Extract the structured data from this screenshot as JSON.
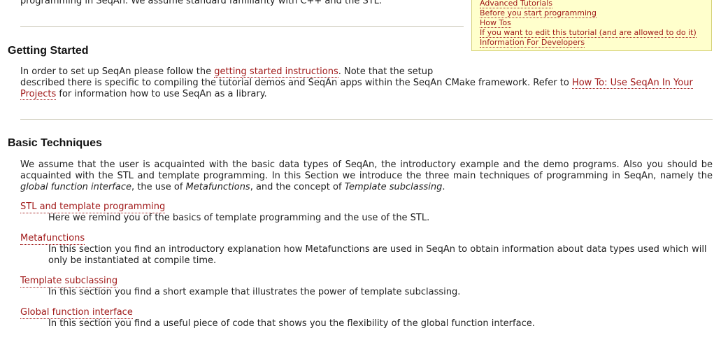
{
  "intro": {
    "partial_line": "programming in SeqAn. We assume standard familiarity with C++ and the STL."
  },
  "toc_box": {
    "items": [
      "Advanced Tutorials",
      "Before you start programming",
      "How Tos",
      "If you want to edit this tutorial (and are allowed to do it)",
      "Information For Developers"
    ]
  },
  "getting_started": {
    "heading": "Getting Started",
    "text_1": "In order to set up SeqAn please follow the ",
    "link_1": "getting started instructions",
    "text_2": ". Note that the setup",
    "text_3": "described there is specific to compiling the tutorial demos and SeqAn apps within the SeqAn CMake framework. Refer to ",
    "link_2": "How To: Use SeqAn In Your Projects",
    "text_4": " for information how to use SeqAn as a library."
  },
  "basic_techniques": {
    "heading": "Basic Techniques",
    "intro_1": "We assume that the user is acquainted with the basic data types of SeqAn, the introductory example and the demo programs. Also you should be acquainted with the STL and template programming. In this Section we introduce the three main techniques of programming in SeqAn, namely the ",
    "em_1": "global function interface",
    "intro_2": ", the use of ",
    "em_2": "Metafunctions",
    "intro_3": ", and the concept of ",
    "em_3": "Template subclassing",
    "intro_4": ".",
    "entries": [
      {
        "term": "STL and template programming",
        "desc": "Here we remind you of the basics of template programming and the use of the STL."
      },
      {
        "term": "Metafunctions",
        "desc": "In this section you find an introductory explanation how Metafunctions are used in SeqAn to obtain information about data types used which will only be instantiated at compile time."
      },
      {
        "term": "Template subclassing",
        "desc": "In this section you find a short example that illustrates the power of template subclassing."
      },
      {
        "term": "Global function interface",
        "desc": "In this section you find a useful piece of code that shows you the flexibility of the global function interface."
      }
    ]
  },
  "colors": {
    "link": "#a11a1a",
    "toc_background": "#ffffcc",
    "toc_border": "#d6d27a",
    "rule": "#ccc9b8"
  }
}
